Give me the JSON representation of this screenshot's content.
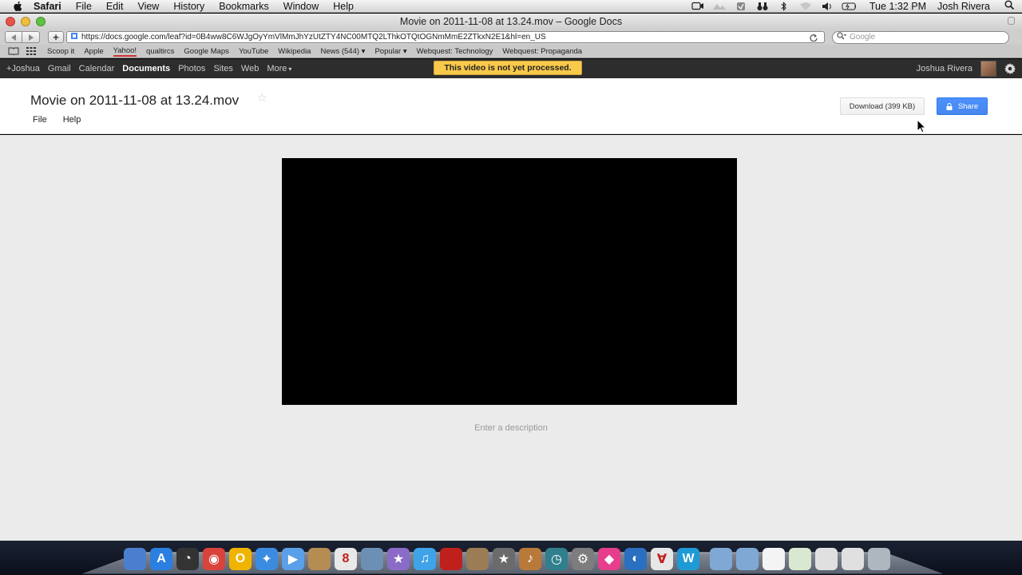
{
  "menubar": {
    "items": [
      "Safari",
      "File",
      "Edit",
      "View",
      "History",
      "Bookmarks",
      "Window",
      "Help"
    ],
    "clock": "Tue 1:32 PM",
    "user": "Josh Rivera"
  },
  "window": {
    "title": "Movie on 2011-11-08 at 13.24.mov – Google Docs"
  },
  "toolbar": {
    "add_label": "+",
    "url": "https://docs.google.com/leaf?id=0B4ww8C6WJgOyYmVlMmJhYzUtZTY4NC00MTQ2LThkOTQtOGNmMmE2ZTkxN2E1&hl=en_US",
    "search_placeholder": "Google"
  },
  "bookmarks": [
    "Scoop it",
    "Apple",
    "Yahoo!",
    "qualtircs",
    "Google Maps",
    "YouTube",
    "Wikipedia",
    "News (544) ▾",
    "Popular ▾",
    "Webquest: Technology",
    "Webquest: Propaganda"
  ],
  "gbar": {
    "items": [
      "+Joshua",
      "Gmail",
      "Calendar",
      "Documents",
      "Photos",
      "Sites",
      "Web"
    ],
    "more_label": "More",
    "more_caret": "▾",
    "active": "Documents",
    "user_name": "Joshua Rivera"
  },
  "notice": "This video is not yet processed.",
  "doc": {
    "title": "Movie on 2011-11-08 at 13.24.mov",
    "star": "☆",
    "menu": [
      "File",
      "Help"
    ],
    "download_label": "Download (399 KB)",
    "share_label": "Share",
    "description_placeholder": "Enter a description"
  },
  "dock": {
    "icons": [
      {
        "name": "finder-icon",
        "color": "#4a7fd0",
        "glyph": ""
      },
      {
        "name": "app-store-icon",
        "color": "#2b7fe0",
        "glyph": "A"
      },
      {
        "name": "dashboard-icon",
        "color": "#333333",
        "glyph": "◔"
      },
      {
        "name": "chrome-icon",
        "color": "#d9433b",
        "glyph": "◉"
      },
      {
        "name": "ring-app-icon",
        "color": "#f0b400",
        "glyph": "O"
      },
      {
        "name": "safari-icon",
        "color": "#3b8ce0",
        "glyph": "✦"
      },
      {
        "name": "facetime-icon",
        "color": "#5aa0e8",
        "glyph": "▶"
      },
      {
        "name": "address-book-icon",
        "color": "#b58d52",
        "glyph": ""
      },
      {
        "name": "ical-icon",
        "color": "#e8e8e8",
        "glyph": "8"
      },
      {
        "name": "iphoto-icon",
        "color": "#6c8fb5",
        "glyph": ""
      },
      {
        "name": "imovie-icon",
        "color": "#8a6bc8",
        "glyph": "★"
      },
      {
        "name": "itunes-icon",
        "color": "#3fa3e8",
        "glyph": "♫"
      },
      {
        "name": "photo-booth-icon",
        "color": "#c0201c",
        "glyph": ""
      },
      {
        "name": "preview-icon",
        "color": "#9a7d55",
        "glyph": ""
      },
      {
        "name": "imovie-star-icon",
        "color": "#6b6b6b",
        "glyph": "★"
      },
      {
        "name": "garageband-icon",
        "color": "#b8793a",
        "glyph": "♪"
      },
      {
        "name": "time-machine-icon",
        "color": "#2f7f8c",
        "glyph": "◷"
      },
      {
        "name": "system-preferences-icon",
        "color": "#7d7d7d",
        "glyph": "⚙"
      },
      {
        "name": "gem-app-icon",
        "color": "#e63e8c",
        "glyph": "◆"
      },
      {
        "name": "network-icon",
        "color": "#2a6fc0",
        "glyph": "◐"
      },
      {
        "name": "acrobat-icon",
        "color": "#e7e7e7",
        "glyph": "∀"
      },
      {
        "name": "word-icon",
        "color": "#1e9ad6",
        "glyph": "W"
      },
      {
        "name": "folder-icon",
        "color": "#7fa9d4",
        "glyph": ""
      },
      {
        "name": "applications-folder-icon",
        "color": "#7fa9d4",
        "glyph": ""
      },
      {
        "name": "document-icon",
        "color": "#f4f4f4",
        "glyph": ""
      },
      {
        "name": "spreadsheet-icon",
        "color": "#d9e8d0",
        "glyph": ""
      },
      {
        "name": "window-icon",
        "color": "#e0e0e0",
        "glyph": ""
      },
      {
        "name": "window-2-icon",
        "color": "#e0e0e0",
        "glyph": ""
      },
      {
        "name": "trash-icon",
        "color": "#aeb6bf",
        "glyph": ""
      }
    ]
  }
}
